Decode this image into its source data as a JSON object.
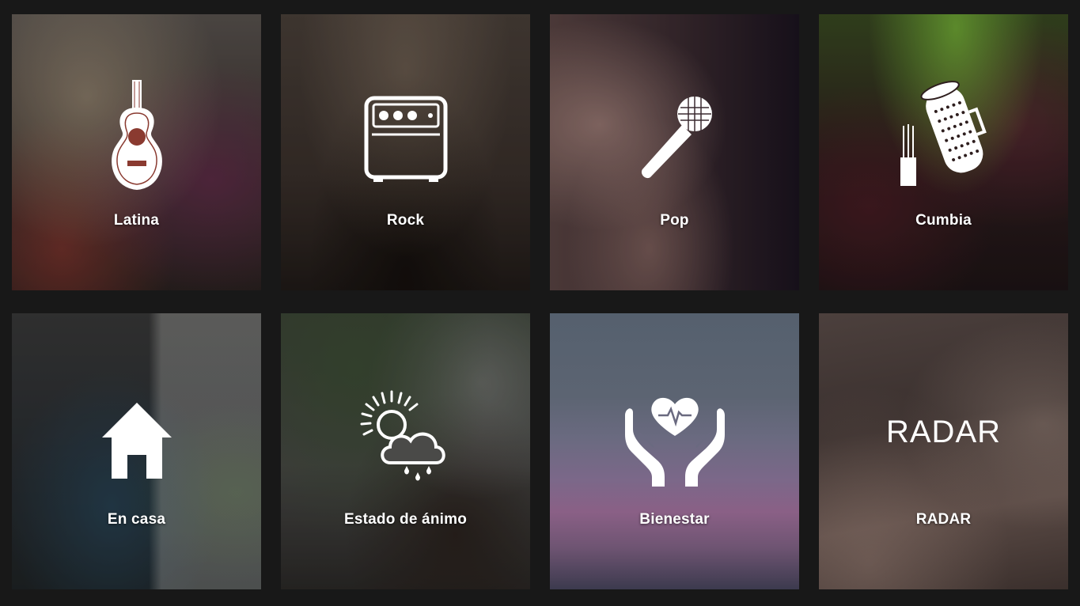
{
  "tiles": [
    {
      "label": "Latina",
      "icon": "guitar-icon"
    },
    {
      "label": "Rock",
      "icon": "amplifier-icon"
    },
    {
      "label": "Pop",
      "icon": "microphone-icon"
    },
    {
      "label": "Cumbia",
      "icon": "guiro-icon"
    },
    {
      "label": "En casa",
      "icon": "house-icon"
    },
    {
      "label": "Estado de ánimo",
      "icon": "sun-cloud-rain-icon"
    },
    {
      "label": "Bienestar",
      "icon": "hands-heart-icon"
    },
    {
      "label": "RADAR",
      "icon": "radar-wordmark",
      "wordmark": "RADAR"
    }
  ],
  "colors": {
    "page_background": "#181818",
    "text": "#ffffff"
  }
}
